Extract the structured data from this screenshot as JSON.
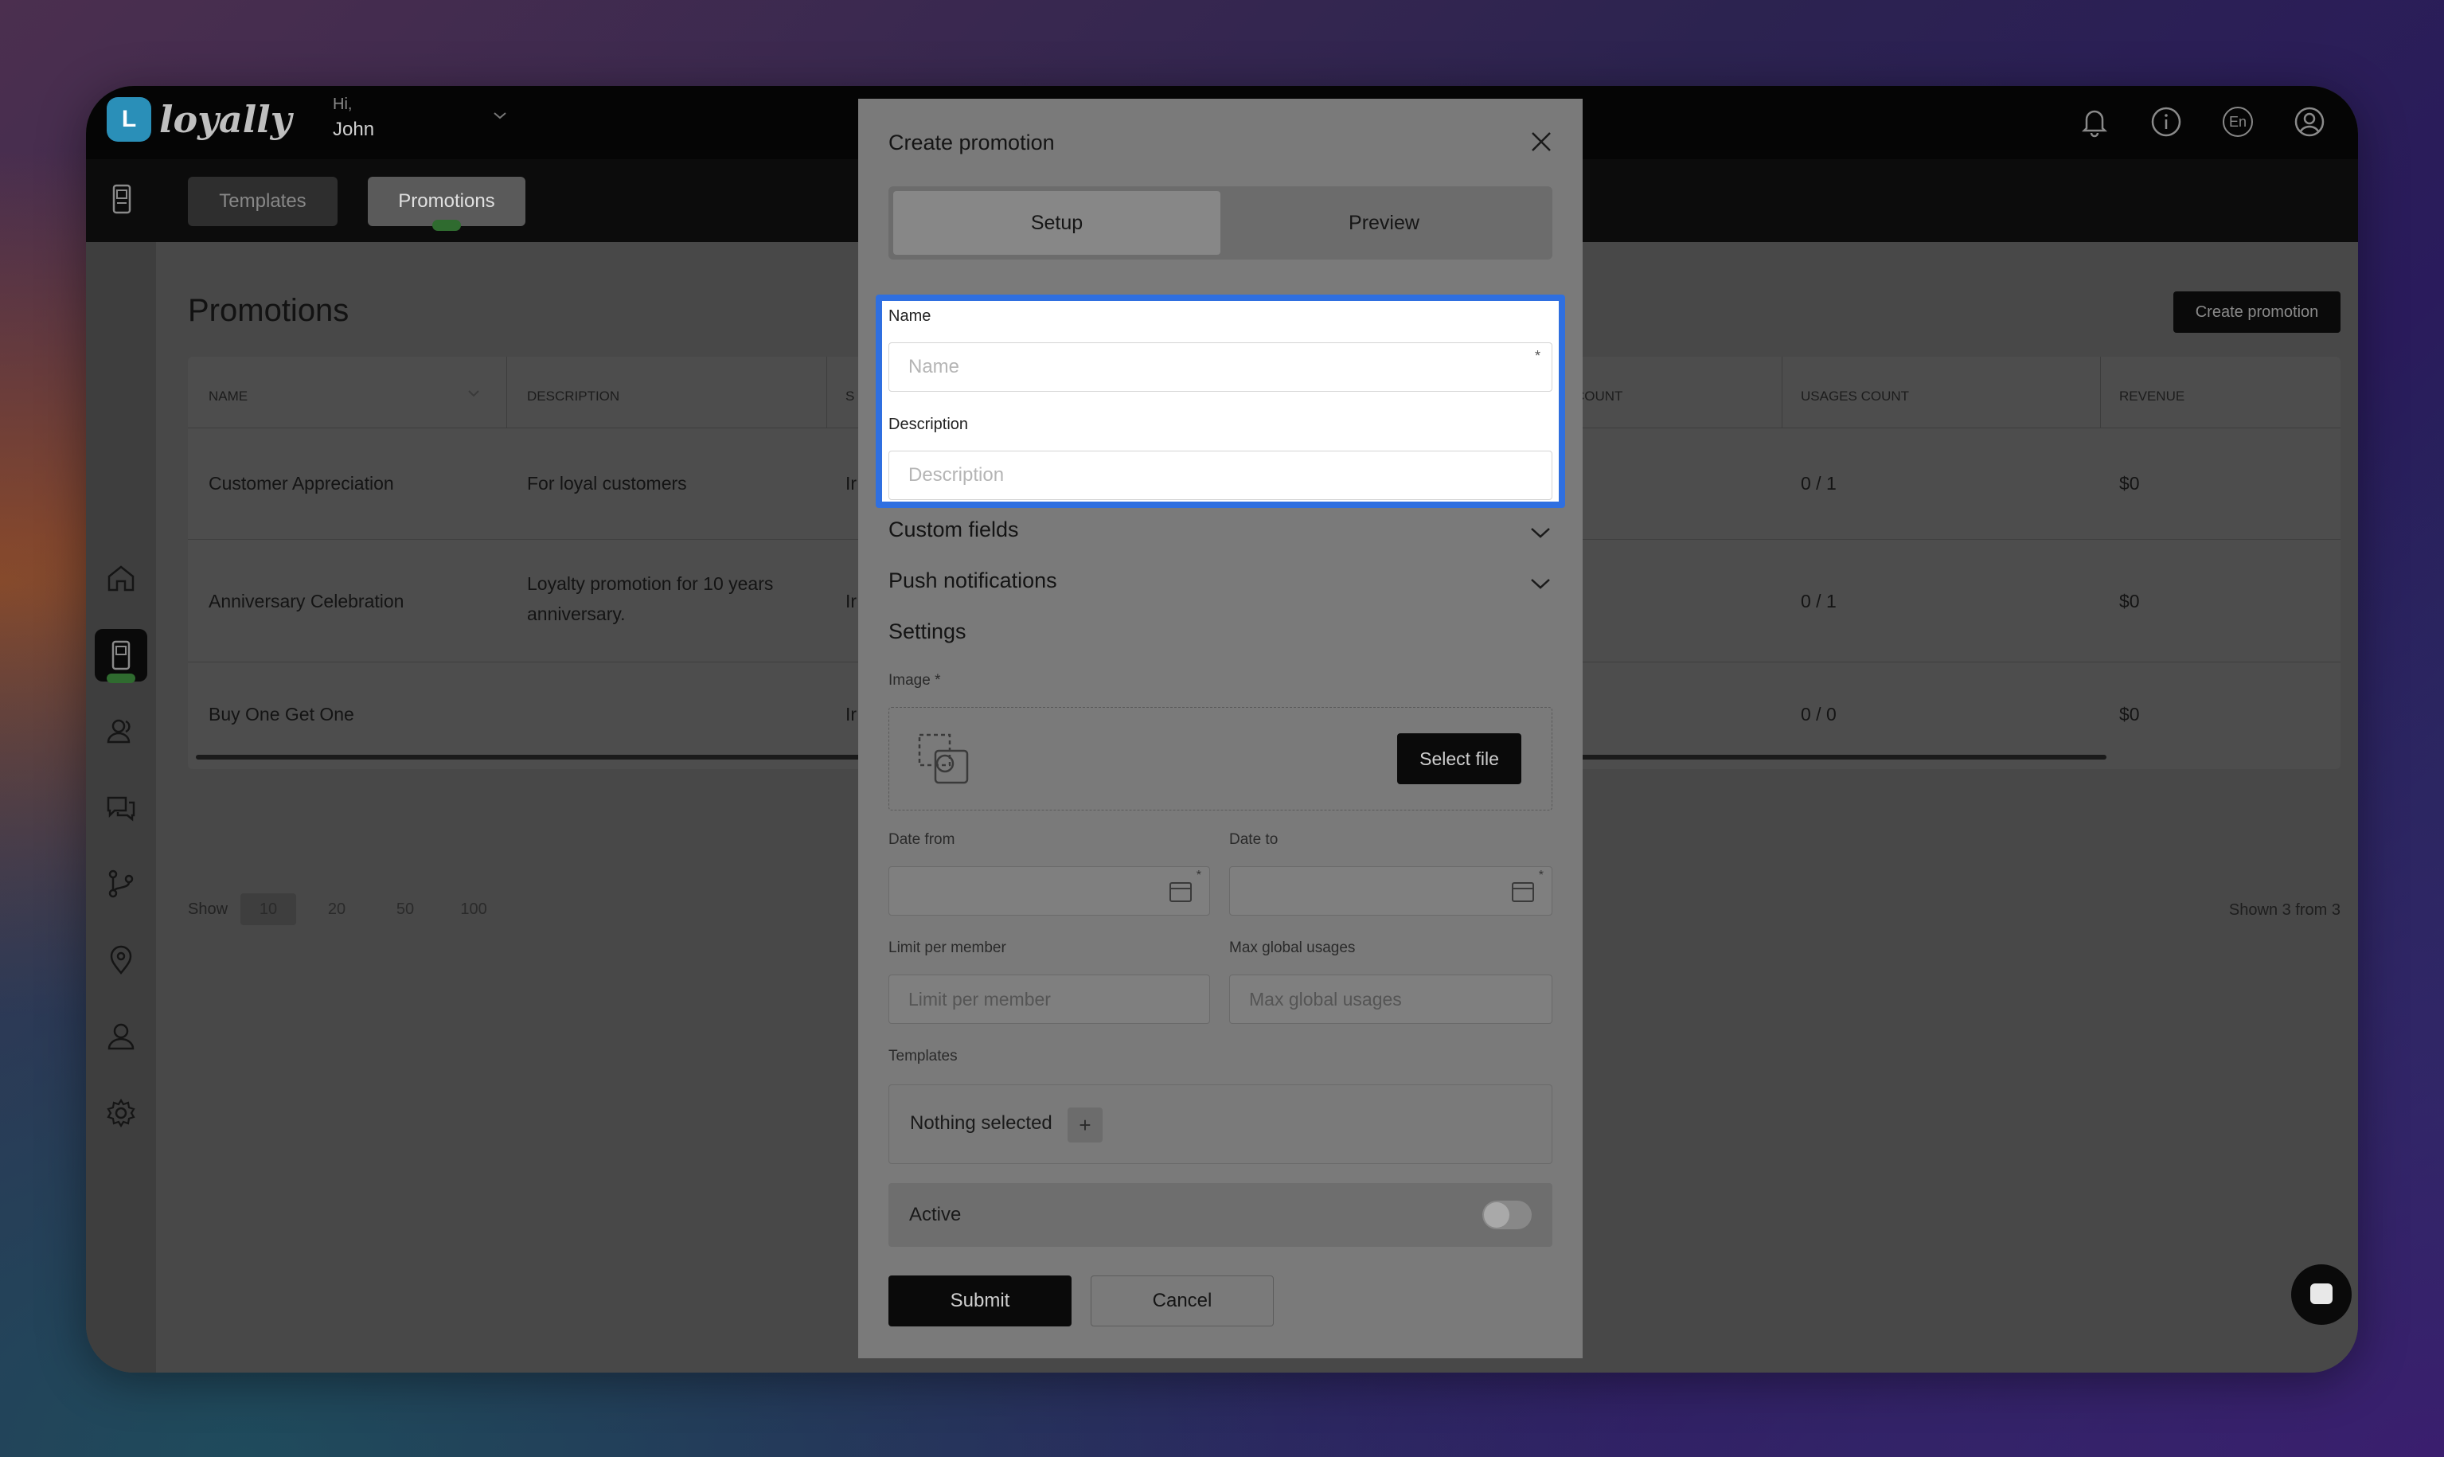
{
  "app": {
    "logo_text": "loyally",
    "greeting_hi": "Hi,",
    "user_name": "John",
    "language": "En"
  },
  "subnav": {
    "templates": "Templates",
    "promotions": "Promotions"
  },
  "page": {
    "title": "Promotions",
    "create_button": "Create promotion"
  },
  "table": {
    "headers": {
      "name": "NAME",
      "description": "DESCRIPTION",
      "s_partial": "S",
      "count_partial": "COUNT",
      "usages_count": "USAGES COUNT",
      "revenue": "REVENUE"
    },
    "rows": [
      {
        "name": "Customer Appreciation",
        "description": "For loyal customers",
        "status_partial": "Ir",
        "usages": "0 / 1",
        "revenue": "$0"
      },
      {
        "name": "Anniversary Celebration",
        "description": "Loyalty promotion for 10 years anniversary.",
        "status_partial": "Ir",
        "usages": "0 / 1",
        "revenue": "$0"
      },
      {
        "name": "Buy One Get One",
        "description": "",
        "status_partial": "Ir",
        "usages": "0 / 0",
        "revenue": "$0"
      }
    ]
  },
  "pager": {
    "show_label": "Show",
    "options": [
      "10",
      "20",
      "50",
      "100"
    ],
    "selected": "10",
    "shown_text": "Shown 3 from 3"
  },
  "modal": {
    "title": "Create promotion",
    "tabs": {
      "setup": "Setup",
      "preview": "Preview"
    },
    "name_label": "Name",
    "name_placeholder": "Name",
    "name_required": "*",
    "description_label": "Description",
    "description_placeholder": "Description",
    "custom_fields": "Custom fields",
    "push_notifications": "Push notifications",
    "settings": "Settings",
    "image_label": "Image *",
    "select_file": "Select file",
    "date_from_label": "Date from",
    "date_to_label": "Date to",
    "date_required": "*",
    "limit_label": "Limit per member",
    "limit_placeholder": "Limit per member",
    "max_label": "Max global usages",
    "max_placeholder": "Max global usages",
    "templates_label": "Templates",
    "nothing_selected": "Nothing selected",
    "plus": "+",
    "active_label": "Active",
    "active_on": false,
    "submit": "Submit",
    "cancel": "Cancel"
  },
  "colors": {
    "highlight": "#2f6fe0",
    "logo": "#2a8fb8",
    "badge": "#2f6b2f"
  }
}
